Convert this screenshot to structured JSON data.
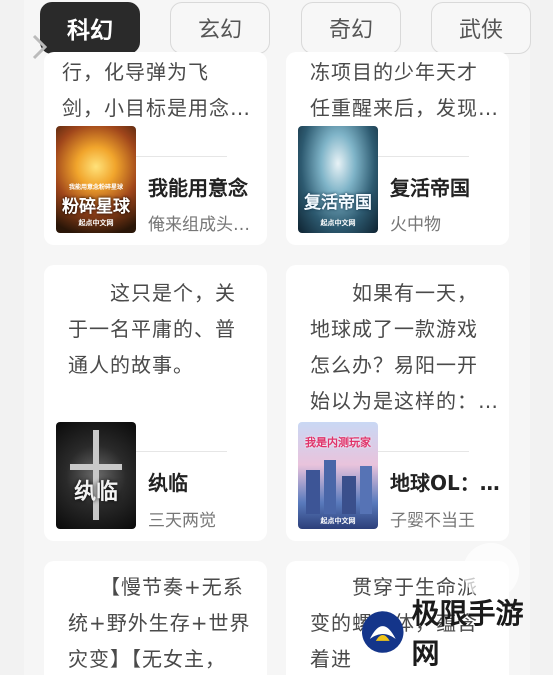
{
  "tabs": [
    {
      "label": "科幻",
      "active": true
    },
    {
      "label": "玄幻",
      "active": false
    },
    {
      "label": "奇幻",
      "active": false
    },
    {
      "label": "武侠",
      "active": false
    }
  ],
  "books": [
    {
      "desc": "行，化导弹为飞\n剑，小目标是用念…",
      "title": "我能用意念",
      "author": "俺来组成头…",
      "cover_text": "粉碎星球",
      "cover_subtext": "我能用意念粉碎星球"
    },
    {
      "desc": "冻项目的少年天才\n任重醒来后，发现…",
      "title": "复活帝国",
      "author": "火中物",
      "cover_text": "复活帝国"
    },
    {
      "desc": "　　这只是个，关\n于一名平庸的、普\n通人的故事。",
      "title": "纨临",
      "author": "三天两觉",
      "cover_text": "纨临"
    },
    {
      "desc": "　　如果有一天，\n地球成了一款游戏\n怎么办？易阳一开\n始以为是这样的：…",
      "title": "地球OL：…",
      "author": "子婴不当王",
      "cover_text": "我是内测玩家"
    },
    {
      "desc": "　　【慢节奏+无系\n统+野外生存+世界\n灾变】【无女主，",
      "title": "",
      "author": ""
    },
    {
      "desc": "　　贯穿于生命派\n变的螺旋体，蕴含\n着进",
      "title": "",
      "author": ""
    }
  ],
  "publisher": "起点中文网",
  "watermark": {
    "text": "极限手游网"
  },
  "colors": {
    "tab_active_bg": "#2a2a2a",
    "card_bg": "#ffffff",
    "page_bg": "#f2f2f2"
  }
}
